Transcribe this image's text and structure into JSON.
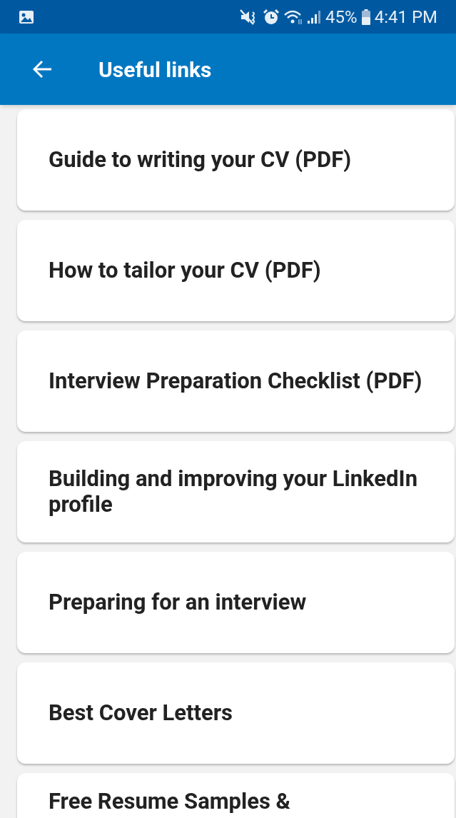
{
  "status_bar": {
    "battery": "45%",
    "time": "4:41 PM"
  },
  "app_bar": {
    "title": "Useful links"
  },
  "links": [
    {
      "label": "Guide to writing your CV (PDF)"
    },
    {
      "label": "How to tailor your CV (PDF)"
    },
    {
      "label": "Interview Preparation Checklist (PDF)"
    },
    {
      "label": "Building and improving your LinkedIn profile"
    },
    {
      "label": "Preparing for an interview"
    },
    {
      "label": "Best Cover Letters"
    },
    {
      "label": "Free Resume Samples &"
    }
  ]
}
